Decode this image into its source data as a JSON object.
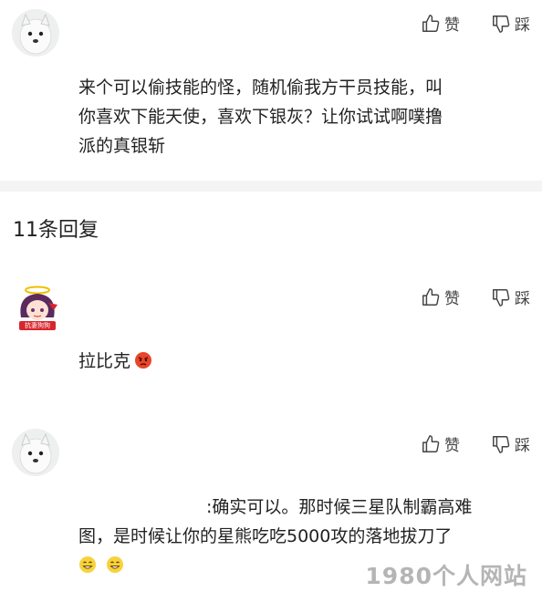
{
  "labels": {
    "like": "赞",
    "dislike": "踩"
  },
  "top_comment": {
    "lines": [
      "来个可以偷技能的怪，随机偷我方干员技能，叫",
      "你喜欢下能天使，喜欢下银灰？让你试试啊噗撸",
      "派的真银斩"
    ]
  },
  "replies_header": "11条回复",
  "replies": [
    {
      "text": "拉比克",
      "emoji": "angry-face"
    },
    {
      "lines": [
        ":确实可以。那时候三星队制霸高难",
        "图，是时候让你的星熊吃吃5000攻的落地拔刀了"
      ],
      "emojis": [
        "grin-face",
        "grin-face"
      ]
    }
  ],
  "avatar_badge": "抗妻狗狗",
  "watermark": "1980个人网站"
}
